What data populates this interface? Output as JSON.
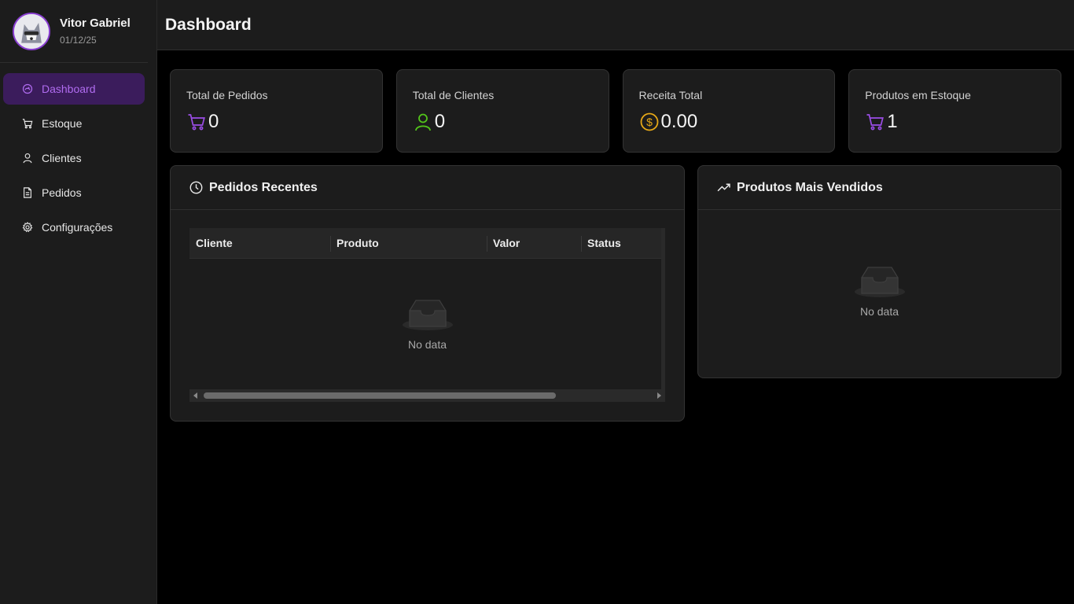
{
  "user": {
    "name": "Vitor Gabriel",
    "date": "01/12/25"
  },
  "sidebar": {
    "items": [
      {
        "label": "Dashboard",
        "icon": "dashboard-icon",
        "active": true
      },
      {
        "label": "Estoque",
        "icon": "cart-icon"
      },
      {
        "label": "Clientes",
        "icon": "user-icon"
      },
      {
        "label": "Pedidos",
        "icon": "file-icon"
      },
      {
        "label": "Configurações",
        "icon": "gear-icon"
      }
    ]
  },
  "header": {
    "title": "Dashboard"
  },
  "stats": [
    {
      "title": "Total de Pedidos",
      "value": "0",
      "icon": "cart-icon",
      "color": "#9b4de6"
    },
    {
      "title": "Total de Clientes",
      "value": "0",
      "icon": "user-icon",
      "color": "#52c41a"
    },
    {
      "title": "Receita Total",
      "value": "0.00",
      "icon": "dollar-icon",
      "color": "#e6a817"
    },
    {
      "title": "Produtos em Estoque",
      "value": "1",
      "icon": "cart-icon",
      "color": "#9b4de6"
    }
  ],
  "recent_orders": {
    "title": "Pedidos Recentes",
    "icon": "clock-icon",
    "columns": [
      "Cliente",
      "Produto",
      "Valor",
      "Status"
    ],
    "rows": [],
    "empty_text": "No data"
  },
  "top_products": {
    "title": "Produtos Mais Vendidos",
    "icon": "trend-up-icon",
    "empty_text": "No data"
  },
  "colors": {
    "accent": "#9b4de6",
    "active_bg": "#3b1c5c",
    "success": "#52c41a",
    "warning": "#e6a817"
  }
}
